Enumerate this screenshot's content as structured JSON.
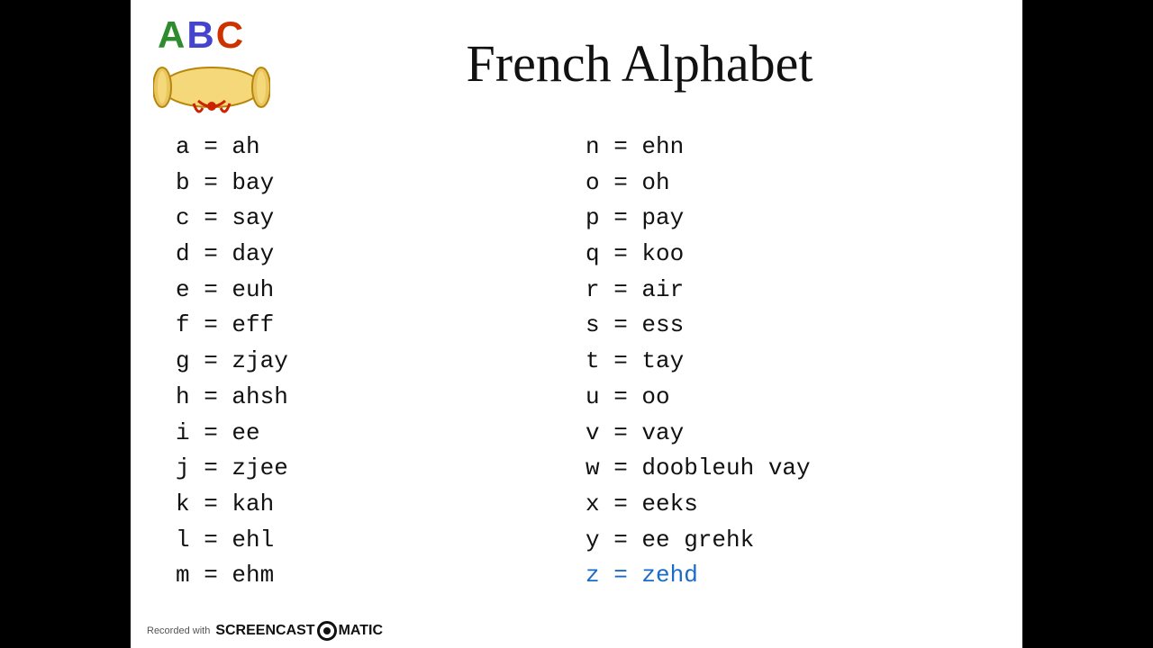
{
  "title": "French Alphabet",
  "left_column": [
    {
      "letter": "a",
      "pronunciation": "ah"
    },
    {
      "letter": "b",
      "pronunciation": "bay"
    },
    {
      "letter": "c",
      "pronunciation": "say"
    },
    {
      "letter": "d",
      "pronunciation": "day"
    },
    {
      "letter": "e",
      "pronunciation": "euh"
    },
    {
      "letter": "f",
      "pronunciation": "eff"
    },
    {
      "letter": "g",
      "pronunciation": "zjay"
    },
    {
      "letter": "h",
      "pronunciation": "ahsh"
    },
    {
      "letter": "i",
      "pronunciation": "ee"
    },
    {
      "letter": "j",
      "pronunciation": "zjee"
    },
    {
      "letter": "k",
      "pronunciation": "kah"
    },
    {
      "letter": "l",
      "pronunciation": "ehl"
    },
    {
      "letter": "m",
      "pronunciation": "ehm"
    }
  ],
  "right_column": [
    {
      "letter": "n",
      "pronunciation": "ehn",
      "highlight": false
    },
    {
      "letter": "o",
      "pronunciation": "oh",
      "highlight": false
    },
    {
      "letter": "p",
      "pronunciation": "pay",
      "highlight": false
    },
    {
      "letter": "q",
      "pronunciation": "koo",
      "highlight": false
    },
    {
      "letter": "r",
      "pronunciation": "air",
      "highlight": false
    },
    {
      "letter": "s",
      "pronunciation": "ess",
      "highlight": false
    },
    {
      "t": "t",
      "letter": "t",
      "pronunciation": "tay",
      "highlight": false
    },
    {
      "letter": "u",
      "pronunciation": "oo",
      "highlight": false
    },
    {
      "letter": "v",
      "pronunciation": "vay",
      "highlight": false
    },
    {
      "letter": "w",
      "pronunciation": "doobleuh vay",
      "highlight": false
    },
    {
      "letter": "x",
      "pronunciation": "eeks",
      "highlight": false
    },
    {
      "letter": "y",
      "pronunciation": "ee grehk",
      "highlight": false
    },
    {
      "letter": "z",
      "pronunciation": "zehd",
      "highlight": true
    }
  ],
  "footer": {
    "recorded_label": "Recorded with",
    "brand": "SCREENCAST",
    "brand_suffix": "MATIC"
  },
  "abc": {
    "a": "A",
    "b": "B",
    "c": "C"
  }
}
